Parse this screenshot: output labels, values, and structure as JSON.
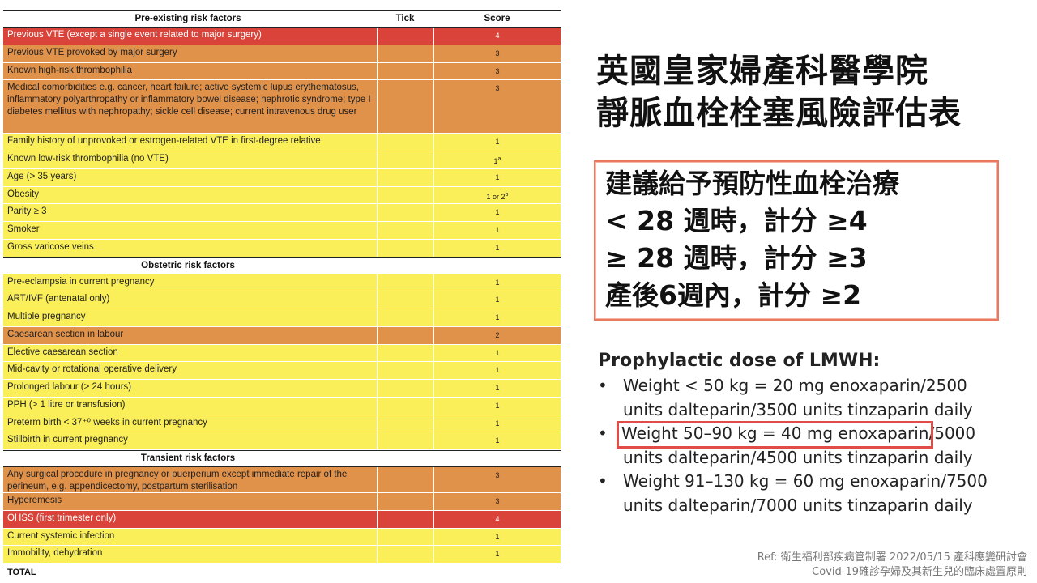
{
  "table": {
    "columns": [
      "Pre-existing risk factors",
      "Tick",
      "Score"
    ],
    "sections": [
      {
        "rows": [
          {
            "label": "Previous VTE (except a single event related to major surgery)",
            "score": "4",
            "color": "red"
          },
          {
            "label": "Previous VTE provoked by major surgery",
            "score": "3",
            "color": "orange"
          },
          {
            "label": "Known high-risk thrombophilia",
            "score": "3",
            "color": "orange"
          },
          {
            "label": "Medical comorbidities e.g. cancer, heart failure; active systemic lupus erythematosus, inflammatory polyarthropathy or inflammatory bowel disease; nephrotic syndrome; type I diabetes mellitus with nephropathy; sickle cell disease; current intravenous drug user",
            "score": "3",
            "color": "orange"
          },
          {
            "label": "Family history of unprovoked or estrogen-related VTE in first-degree relative",
            "score": "1",
            "color": "yellow"
          },
          {
            "label": "Known low-risk thrombophilia (no VTE)",
            "score": "1",
            "sup": "a",
            "color": "yellow"
          },
          {
            "label": "Age (> 35 years)",
            "score": "1",
            "color": "yellow"
          },
          {
            "label": "Obesity",
            "score": "1 or 2",
            "sup": "b",
            "color": "yellow"
          },
          {
            "label": "Parity ≥ 3",
            "score": "1",
            "color": "yellow"
          },
          {
            "label": "Smoker",
            "score": "1",
            "color": "yellow"
          },
          {
            "label": "Gross varicose veins",
            "score": "1",
            "color": "yellow"
          }
        ]
      },
      {
        "title": "Obstetric risk factors",
        "rows": [
          {
            "label": "Pre-eclampsia in current pregnancy",
            "score": "1",
            "color": "yellow"
          },
          {
            "label": "ART/IVF (antenatal only)",
            "score": "1",
            "color": "yellow"
          },
          {
            "label": "Multiple pregnancy",
            "score": "1",
            "color": "yellow"
          },
          {
            "label": "Caesarean section in labour",
            "score": "2",
            "color": "orange"
          },
          {
            "label": "Elective caesarean section",
            "score": "1",
            "color": "yellow"
          },
          {
            "label": "Mid-cavity or rotational operative delivery",
            "score": "1",
            "color": "yellow"
          },
          {
            "label": "Prolonged labour (> 24 hours)",
            "score": "1",
            "color": "yellow"
          },
          {
            "label": "PPH (> 1 litre or transfusion)",
            "score": "1",
            "color": "yellow"
          },
          {
            "label": "Preterm birth < 37⁺⁰ weeks in current pregnancy",
            "score": "1",
            "color": "yellow"
          },
          {
            "label": "Stillbirth in current pregnancy",
            "score": "1",
            "color": "yellow"
          }
        ]
      },
      {
        "title": "Transient risk factors",
        "rows": [
          {
            "label": "Any surgical procedure in pregnancy or puerperium except immediate repair of the perineum, e.g. appendicectomy, postpartum sterilisation",
            "score": "3",
            "color": "orange"
          },
          {
            "label": "Hyperemesis",
            "score": "3",
            "color": "orange"
          },
          {
            "label": "OHSS (first trimester only)",
            "score": "4",
            "color": "red"
          },
          {
            "label": "Current systemic infection",
            "score": "1",
            "color": "yellow"
          },
          {
            "label": "Immobility, dehydration",
            "score": "1",
            "color": "yellow"
          }
        ]
      }
    ],
    "total_label": "TOTAL"
  },
  "title": {
    "line1": "英國皇家婦產科醫學院",
    "line2": "靜脈血栓栓塞風險評估表"
  },
  "recommendation": {
    "lines": [
      "建議給予預防性血栓治療",
      "< 28 週時，計分 ≥4",
      "≥ 28 週時，計分 ≥3",
      "產後6週內，計分 ≥2"
    ]
  },
  "lmwh": {
    "heading": "Prophylactic dose of LMWH:",
    "bullet": "•",
    "items": [
      {
        "text": "Weight < 50 kg = 20 mg enoxaparin/2500 units dalteparin/3500 units tinzaparin daily"
      },
      {
        "highlight": "Weight 50–90 kg = 40 mg enoxaparin",
        "rest": "/5000 units dalteparin/4500 units tinzaparin daily"
      },
      {
        "text": "Weight 91–130 kg = 60 mg enoxaparin/7500 units dalteparin/7000 units tinzaparin daily"
      }
    ]
  },
  "reference": {
    "line1": "Ref: 衛生福利部疾病管制署 2022/05/15 產科應變研討會",
    "line2": "Covid-19確診孕婦及其新生兒的臨床處置原則"
  }
}
